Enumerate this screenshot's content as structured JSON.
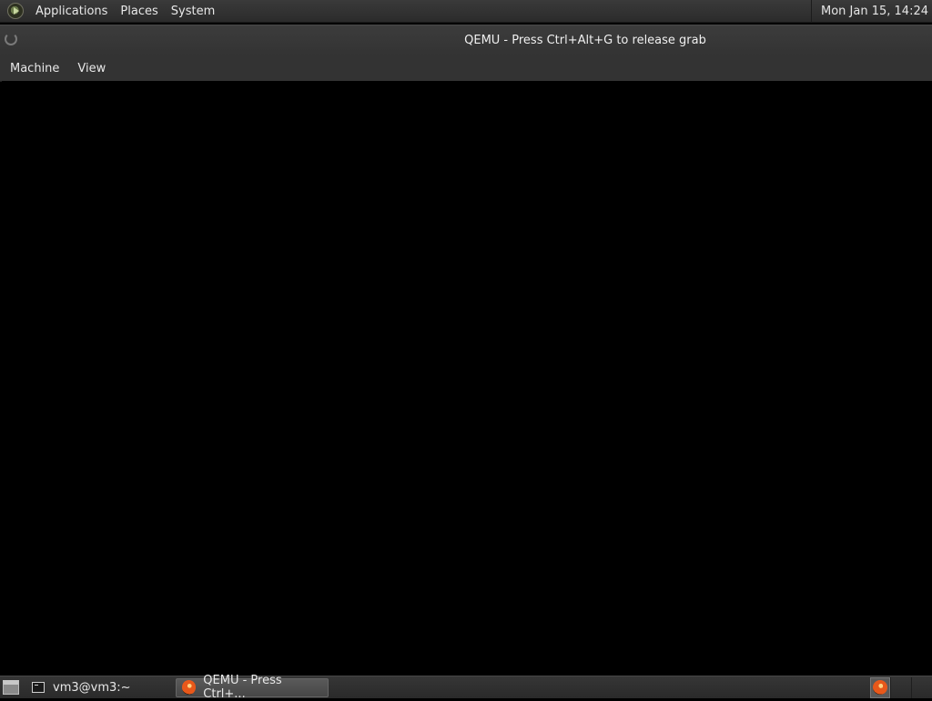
{
  "top_panel": {
    "menus": [
      "Applications",
      "Places",
      "System"
    ],
    "clock": "Mon Jan 15, 14:24"
  },
  "window": {
    "title": "QEMU - Press Ctrl+Alt+G to release grab",
    "menubar": [
      "Machine",
      "View"
    ]
  },
  "taskbar": {
    "tasks": [
      {
        "label": "vm3@vm3:~",
        "icon": "terminal-icon"
      },
      {
        "label": "QEMU - Press Ctrl+...",
        "icon": "qemu-icon"
      }
    ]
  },
  "colors": {
    "panel_bg": "#2e2e2e",
    "display_bg": "#000000",
    "accent": "#e8581a"
  }
}
